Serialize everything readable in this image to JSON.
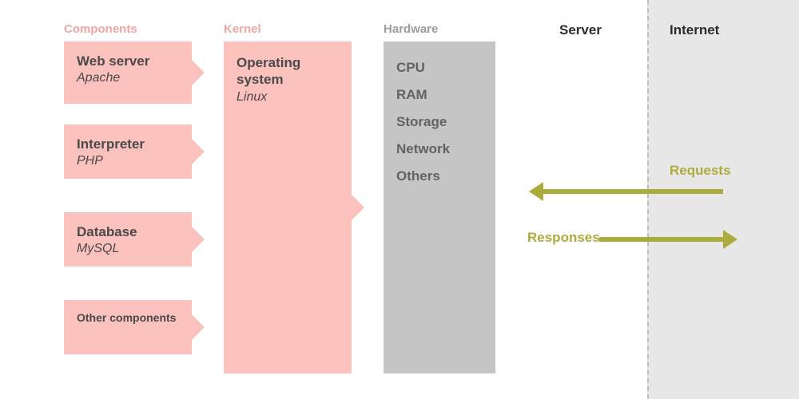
{
  "headers": {
    "components": "Components",
    "kernel": "Kernel",
    "hardware": "Hardware",
    "server": "Server",
    "internet": "Internet"
  },
  "components": [
    {
      "title": "Web server",
      "subtitle": "Apache"
    },
    {
      "title": "Interpreter",
      "subtitle": "PHP"
    },
    {
      "title": "Database",
      "subtitle": "MySQL"
    },
    {
      "title": "Other components",
      "subtitle": ""
    }
  ],
  "kernel": {
    "title": "Operating system",
    "subtitle": "Linux"
  },
  "hardware": [
    "CPU",
    "RAM",
    "Storage",
    "Network",
    "Others"
  ],
  "arrows": {
    "requests": "Requests",
    "responses": "Responses"
  },
  "colors": {
    "pink": "#fac1bd",
    "pink_text": "#f2a6a2",
    "grey_box": "#c5c5c5",
    "grey_text": "#9c9c9c",
    "olive": "#acac3d",
    "dark": "#2c2c2c",
    "bg_internet": "#e7e7e7"
  }
}
